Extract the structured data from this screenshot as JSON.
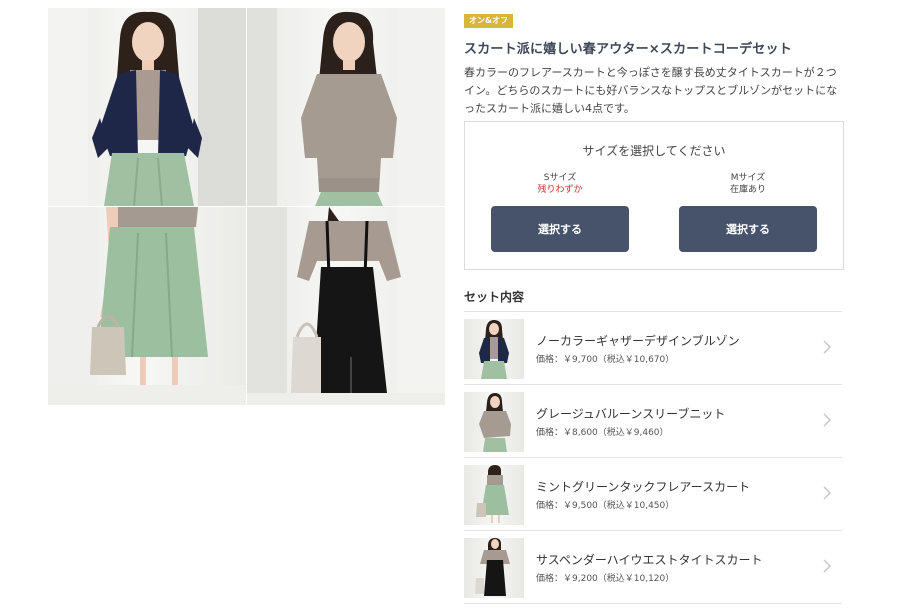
{
  "gallery": {
    "photos": [
      {
        "icon": "model-navy-jacket-photo"
      },
      {
        "icon": "model-greige-knit-photo"
      },
      {
        "icon": "model-mint-skirt-photo"
      },
      {
        "icon": "model-black-suspender-skirt-photo"
      }
    ]
  },
  "product": {
    "badge": "オン&オフ",
    "title": "スカート派に嬉しい春アウター×スカートコーデセット",
    "description": "春カラーのフレアースカートと今っぽさを醸す長め丈タイトスカートが２つイン。どちらのスカートにも好バランスなトップスとブルゾンがセットになったスカート派に嬉しい4点です。"
  },
  "size_selector": {
    "prompt": "サイズを選択してください",
    "sizes": [
      {
        "name": "Sサイズ",
        "stock": "残りわずか",
        "button": "選択する"
      },
      {
        "name": "Mサイズ",
        "stock": "在庫あり",
        "button": "選択する"
      }
    ]
  },
  "set": {
    "heading": "セット内容",
    "items": [
      {
        "name": "ノーカラーギャザーデザインブルゾン",
        "price": "価格：￥9,700（税込￥10,670）"
      },
      {
        "name": "グレージュバルーンスリーブニット",
        "price": "価格：￥8,600（税込￥9,460）"
      },
      {
        "name": "ミントグリーンタックフレアースカート",
        "price": "価格：￥9,500（税込￥10,450）"
      },
      {
        "name": "サスペンダーハイウエストタイトスカート",
        "price": "価格：￥9,200（税込￥10,120）"
      }
    ]
  },
  "colors": {
    "accent_badge": "#d7b53a",
    "button": "#46536b",
    "low_stock": "#c0392b",
    "title": "#3d4656"
  }
}
